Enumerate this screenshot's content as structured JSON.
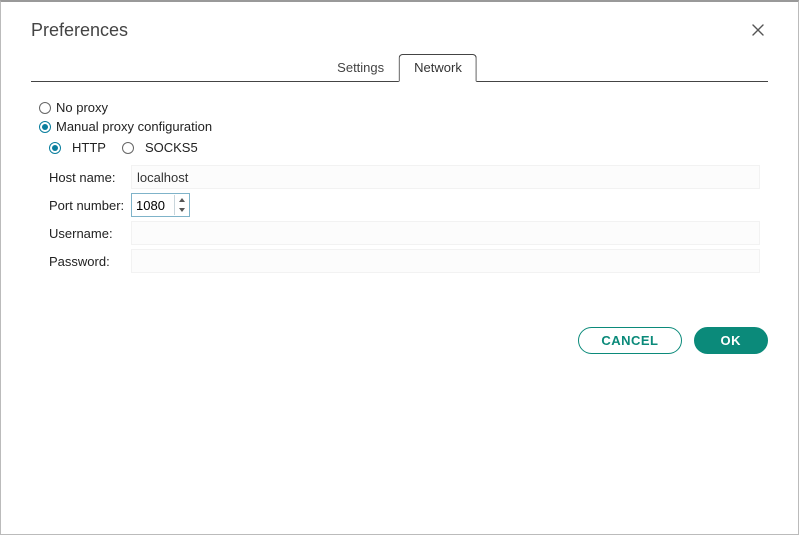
{
  "dialog": {
    "title": "Preferences"
  },
  "tabs": {
    "settings": "Settings",
    "network": "Network"
  },
  "proxy": {
    "no_proxy_label": "No proxy",
    "manual_label": "Manual proxy configuration",
    "http_label": "HTTP",
    "socks5_label": "SOCKS5"
  },
  "fields": {
    "host_label": "Host name:",
    "host_value": "localhost",
    "port_label": "Port number:",
    "port_value": "1080",
    "username_label": "Username:",
    "username_value": "",
    "password_label": "Password:",
    "password_value": ""
  },
  "buttons": {
    "cancel": "CANCEL",
    "ok": "OK"
  }
}
